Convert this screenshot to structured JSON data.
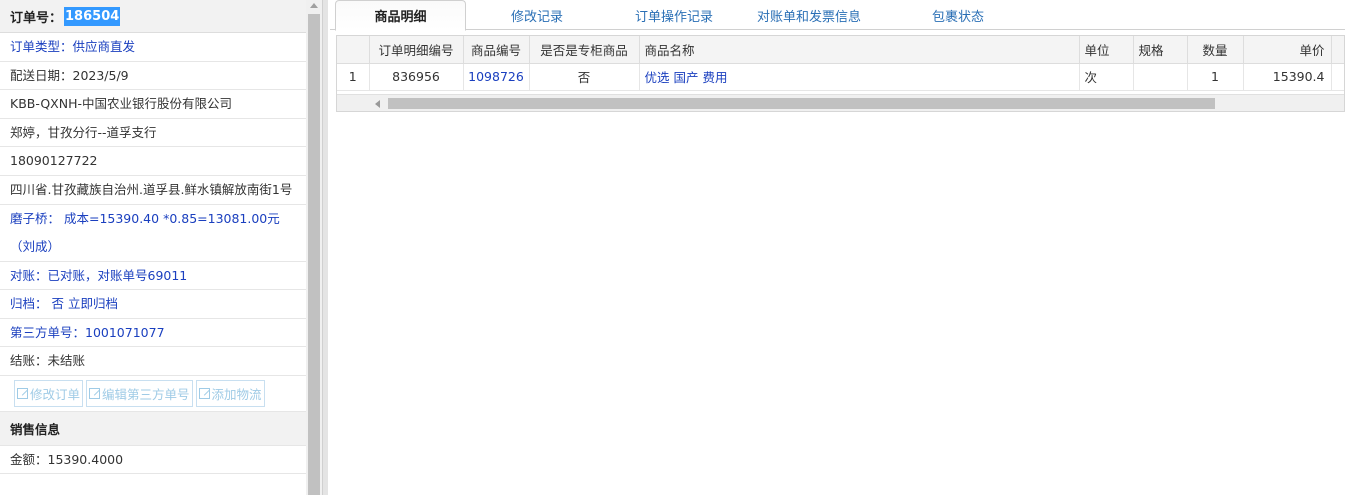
{
  "order": {
    "label": "订单号：",
    "number": "186504"
  },
  "info": [
    {
      "text": "订单类型：供应商直发",
      "blue": true
    },
    {
      "text": "配送日期：2023/5/9",
      "blue": false
    },
    {
      "text": "KBB-QXNH-中国农业银行股份有限公司",
      "blue": false
    },
    {
      "text": "郑婷，甘孜分行--道孚支行",
      "blue": false
    },
    {
      "text": "18090127722",
      "blue": false
    }
  ],
  "address": "四川省.甘孜藏族自治州.道孚县.鲜水镇解放南街1号",
  "cost_note": "磨子桥： 成本=15390.40 *0.85=13081.00元（刘成）",
  "info2": [
    {
      "text": "对账：已对账，对账单号69011",
      "blue": true
    },
    {
      "text": "归档： 否 立即归档",
      "blue": true
    },
    {
      "text": "第三方单号：1001071077",
      "blue": true
    },
    {
      "text": "结账：未结账",
      "blue": false
    }
  ],
  "buttons": {
    "edit_order": "修改订单",
    "edit_third": "编辑第三方单号",
    "add_logistics": "添加物流"
  },
  "sales": {
    "title": "销售信息",
    "amount": "金额：15390.4000"
  },
  "tabs": [
    "商品明细",
    "修改记录",
    "订单操作记录",
    "对账单和发票信息",
    "包裹状态"
  ],
  "table": {
    "headers": [
      "",
      "订单明细编号",
      "商品编号",
      "是否是专柜商品",
      "商品名称",
      "单位",
      "规格",
      "数量",
      "单价"
    ],
    "rows": [
      [
        "1",
        "836956",
        "1098726",
        "否",
        "优选 国产 费用",
        "次",
        "",
        "1",
        "15390.4"
      ]
    ]
  },
  "colors": {
    "accent": "#3399ff",
    "link": "#1a3fbf",
    "tab_link": "#2a6fb5"
  }
}
